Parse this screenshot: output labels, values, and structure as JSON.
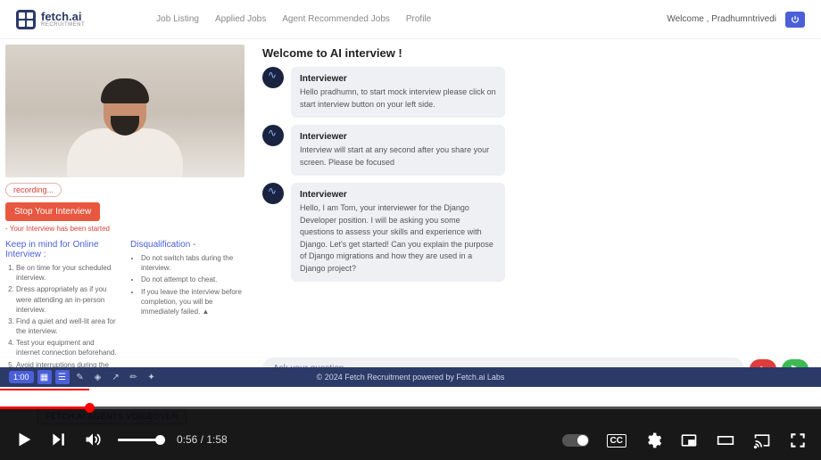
{
  "header": {
    "logo_name": "fetch.ai",
    "logo_sub": "RECRUITMENT",
    "nav": [
      "Job Listing",
      "Applied Jobs",
      "Agent Recommended Jobs",
      "Profile"
    ],
    "welcome": "Welcome , Pradhumntrivedi"
  },
  "left": {
    "recording": "recording...",
    "stop_btn": "Stop Your Interview",
    "started_note": "- Your Interview has been started",
    "tips_title": "Keep in mind for Online Interview :",
    "tips": [
      "Be on time for your scheduled interview.",
      "Dress appropriately as if you were attending an in-person interview.",
      "Find a quiet and well-lit area for the interview.",
      "Test your equipment and internet connection beforehand.",
      "Avoid interruptions during the interview."
    ],
    "disq_title": "Disqualification -",
    "disq": [
      "Do not switch tabs during the interview.",
      "Do not attempt to cheat.",
      "If you leave the interview before completion, you will be immediately failed. ▲"
    ]
  },
  "chat": {
    "title": "Welcome to AI interview !",
    "messages": [
      {
        "name": "Interviewer",
        "text": "Hello pradhumn, to start mock interview please click on start interview button on your left side."
      },
      {
        "name": "Interviewer",
        "text": "Interview will start at any second after you share your screen. Please be focused"
      },
      {
        "name": "Interviewer",
        "text": "Hello, I am Tom, your interviewer for the Django Developer position. I will be asking you some questions to assess your skills and experience with Django. Let's get started! Can you explain the purpose of Django migrations and how they are used in a Django project?"
      }
    ],
    "placeholder": "Ask your question..."
  },
  "footer": {
    "time_pill": "1:00",
    "copyright": "© 2024 Fetch Recruitment powered by Fetch.ai Labs"
  },
  "caption": "FETCH.AI AGENTS VOICEOVER",
  "player": {
    "current": "0:56",
    "duration": "1:58",
    "cc": "CC"
  }
}
